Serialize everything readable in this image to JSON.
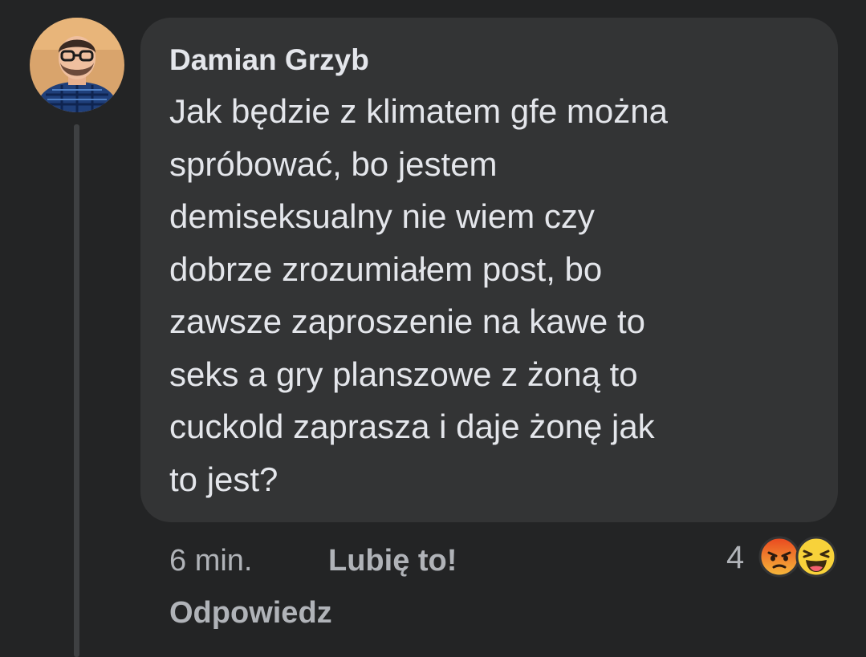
{
  "comment": {
    "author": "Damian Grzyb",
    "text_lines": [
      "Jak będzie z klimatem gfe można",
      "spróbować, bo jestem",
      "demiseksualny nie wiem czy",
      "dobrze zrozumiałem post, bo",
      "zawsze zaproszenie na kawe to",
      "seks a gry planszowe z żoną to",
      "cuckold zaprasza i daje żonę jak",
      "to jest?"
    ]
  },
  "meta": {
    "timestamp": "6 min.",
    "like_label": "Lubię to!",
    "reply_label": "Odpowiedz"
  },
  "reactions": {
    "count": "4",
    "icons": [
      "angry-reaction-icon",
      "haha-reaction-icon"
    ]
  },
  "colors": {
    "background": "#232425",
    "bubble": "#333435",
    "primary_text": "#e4e6eb",
    "secondary_text": "#b0b3b8"
  }
}
